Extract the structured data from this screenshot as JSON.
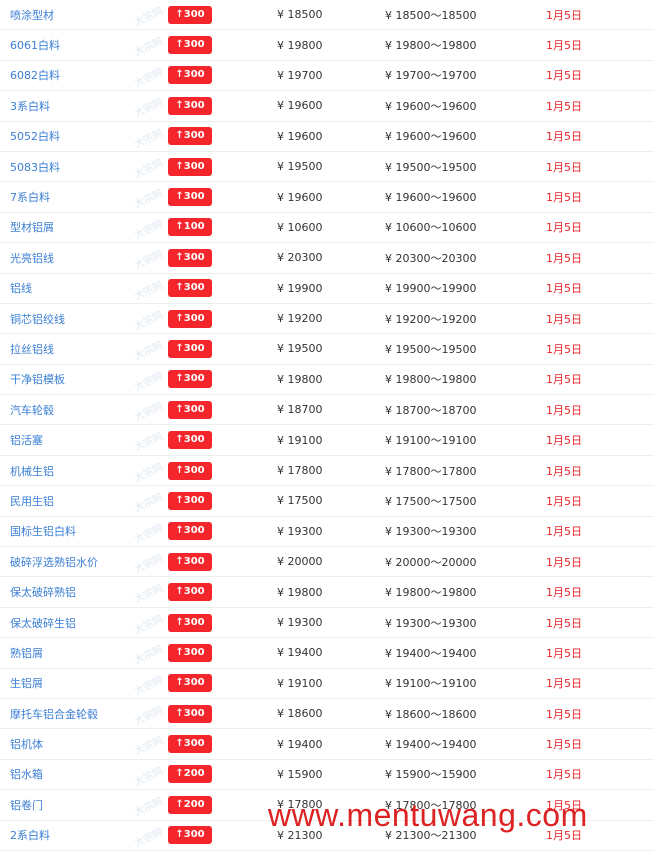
{
  "table": {
    "rows": [
      {
        "name": "喷涂型材",
        "change": "↑300",
        "price": "¥ 18500",
        "range": "¥ 18500～18500",
        "date": "1月5日"
      },
      {
        "name": "6061白料",
        "change": "↑300",
        "price": "¥ 19800",
        "range": "¥ 19800～19800",
        "date": "1月5日"
      },
      {
        "name": "6082白料",
        "change": "↑300",
        "price": "¥ 19700",
        "range": "¥ 19700～19700",
        "date": "1月5日"
      },
      {
        "name": "3系白料",
        "change": "↑300",
        "price": "¥ 19600",
        "range": "¥ 19600～19600",
        "date": "1月5日"
      },
      {
        "name": "5052白料",
        "change": "↑300",
        "price": "¥ 19600",
        "range": "¥ 19600～19600",
        "date": "1月5日"
      },
      {
        "name": "5083白料",
        "change": "↑300",
        "price": "¥ 19500",
        "range": "¥ 19500～19500",
        "date": "1月5日"
      },
      {
        "name": "7系白料",
        "change": "↑300",
        "price": "¥ 19600",
        "range": "¥ 19600～19600",
        "date": "1月5日"
      },
      {
        "name": "型材铝屑",
        "change": "↑100",
        "price": "¥ 10600",
        "range": "¥ 10600～10600",
        "date": "1月5日"
      },
      {
        "name": "光亮铝线",
        "change": "↑300",
        "price": "¥ 20300",
        "range": "¥ 20300～20300",
        "date": "1月5日"
      },
      {
        "name": "铝线",
        "change": "↑300",
        "price": "¥ 19900",
        "range": "¥ 19900～19900",
        "date": "1月5日"
      },
      {
        "name": "铜芯铝绞线",
        "change": "↑300",
        "price": "¥ 19200",
        "range": "¥ 19200～19200",
        "date": "1月5日"
      },
      {
        "name": "拉丝铝线",
        "change": "↑300",
        "price": "¥ 19500",
        "range": "¥ 19500～19500",
        "date": "1月5日"
      },
      {
        "name": "干净铝模板",
        "change": "↑300",
        "price": "¥ 19800",
        "range": "¥ 19800～19800",
        "date": "1月5日"
      },
      {
        "name": "汽车轮毂",
        "change": "↑300",
        "price": "¥ 18700",
        "range": "¥ 18700～18700",
        "date": "1月5日"
      },
      {
        "name": "铝活塞",
        "change": "↑300",
        "price": "¥ 19100",
        "range": "¥ 19100～19100",
        "date": "1月5日"
      },
      {
        "name": "机械生铝",
        "change": "↑300",
        "price": "¥ 17800",
        "range": "¥ 17800～17800",
        "date": "1月5日"
      },
      {
        "name": "民用生铝",
        "change": "↑300",
        "price": "¥ 17500",
        "range": "¥ 17500～17500",
        "date": "1月5日"
      },
      {
        "name": "国标生铝白料",
        "change": "↑300",
        "price": "¥ 19300",
        "range": "¥ 19300～19300",
        "date": "1月5日"
      },
      {
        "name": "破碎浮选熟铝水价",
        "change": "↑300",
        "price": "¥ 20000",
        "range": "¥ 20000～20000",
        "date": "1月5日"
      },
      {
        "name": "保太破碎熟铝",
        "change": "↑300",
        "price": "¥ 19800",
        "range": "¥ 19800～19800",
        "date": "1月5日"
      },
      {
        "name": "保太破碎生铝",
        "change": "↑300",
        "price": "¥ 19300",
        "range": "¥ 19300～19300",
        "date": "1月5日"
      },
      {
        "name": "熟铝屑",
        "change": "↑300",
        "price": "¥ 19400",
        "range": "¥ 19400～19400",
        "date": "1月5日"
      },
      {
        "name": "生铝屑",
        "change": "↑300",
        "price": "¥ 19100",
        "range": "¥ 19100～19100",
        "date": "1月5日"
      },
      {
        "name": "摩托车铝合金轮毂",
        "change": "↑300",
        "price": "¥ 18600",
        "range": "¥ 18600～18600",
        "date": "1月5日"
      },
      {
        "name": "铝机体",
        "change": "↑300",
        "price": "¥ 19400",
        "range": "¥ 19400～19400",
        "date": "1月5日"
      },
      {
        "name": "铝水箱",
        "change": "↑200",
        "price": "¥ 15900",
        "range": "¥ 15900～15900",
        "date": "1月5日"
      },
      {
        "name": "铝卷门",
        "change": "↑200",
        "price": "¥ 17800",
        "range": "¥ 17800～17800",
        "date": "1月5日"
      },
      {
        "name": "2系白料",
        "change": "↑300",
        "price": "¥ 21300",
        "range": "¥ 21300～21300",
        "date": "1月5日"
      }
    ]
  },
  "watermark": {
    "text": "www.mentuwang.com"
  },
  "row_watermark": {
    "text": "大宗网"
  },
  "colors": {
    "accent_red": "#f5262b",
    "link_blue": "#3b7fd4",
    "date_red": "#e8242a"
  }
}
